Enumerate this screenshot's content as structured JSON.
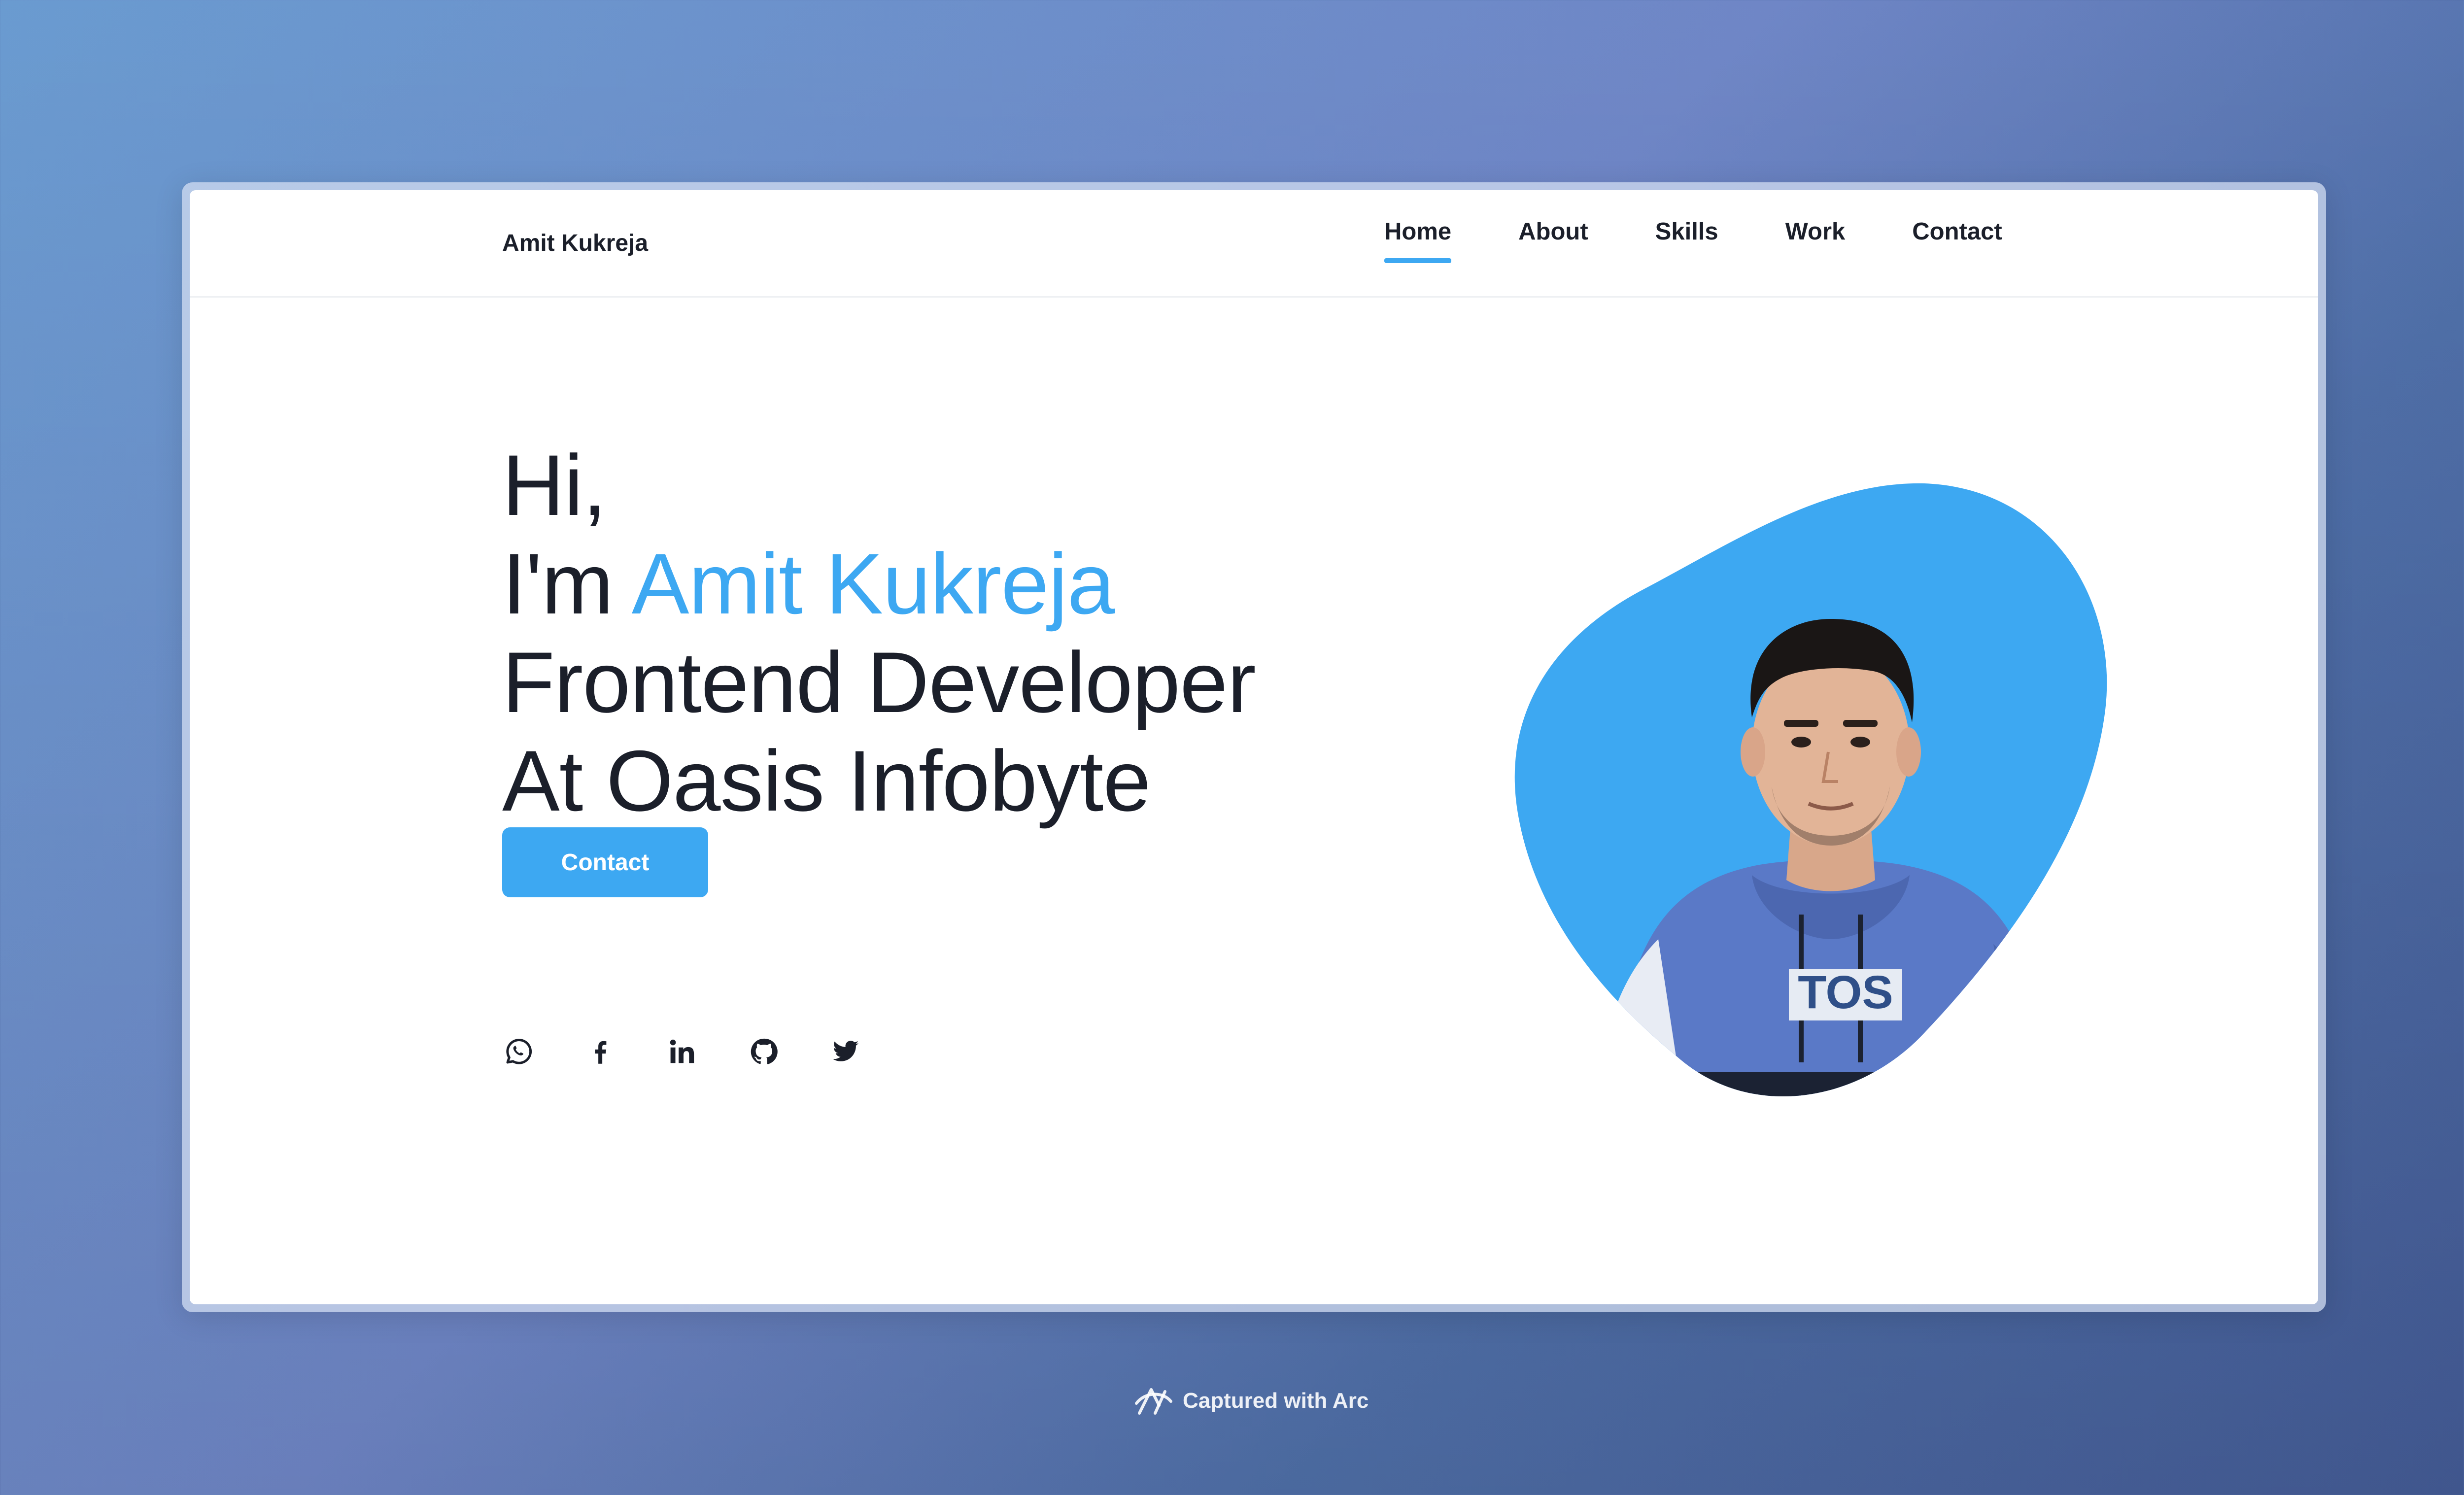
{
  "window": {
    "brand": "Amit Kukreja",
    "nav": [
      {
        "label": "Home",
        "active": true
      },
      {
        "label": "About",
        "active": false
      },
      {
        "label": "Skills",
        "active": false
      },
      {
        "label": "Work",
        "active": false
      },
      {
        "label": "Contact",
        "active": false
      }
    ]
  },
  "hero": {
    "greeting": "Hi,",
    "intro_prefix": "I'm",
    "name": "Amit Kukreja",
    "role": "Frontend Developer",
    "company_line": "At Oasis Infobyte",
    "contact_button": "Contact",
    "socials": [
      {
        "icon": "whatsapp-icon"
      },
      {
        "icon": "facebook-icon"
      },
      {
        "icon": "linkedin-icon"
      },
      {
        "icon": "github-icon"
      },
      {
        "icon": "twitter-icon"
      }
    ],
    "portrait_shirt_text": "TOS"
  },
  "caption": {
    "text": "Captured with Arc"
  },
  "colors": {
    "accent": "#3da8f2",
    "text": "#1b1f2a"
  }
}
